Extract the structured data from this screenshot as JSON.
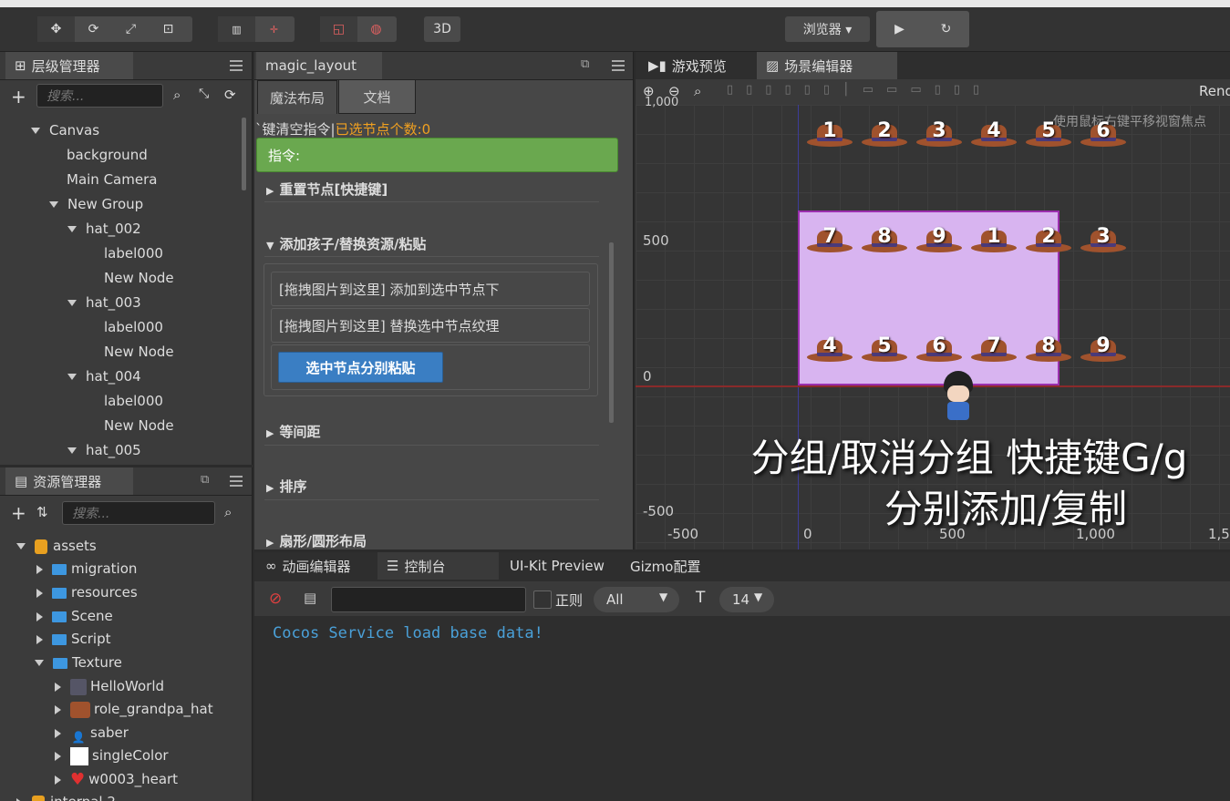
{
  "toolbar": {
    "browser_label": "浏览器 ▾",
    "btn_3d": "3D"
  },
  "hierarchy": {
    "title": "层级管理器",
    "search_placeholder": "搜索...",
    "nodes": [
      {
        "label": "Canvas",
        "expanded": true
      },
      {
        "label": "background"
      },
      {
        "label": "Main Camera"
      },
      {
        "label": "New Group",
        "expanded": true
      },
      {
        "label": "hat_002",
        "expanded": true
      },
      {
        "label": "label000"
      },
      {
        "label": "New Node"
      },
      {
        "label": "hat_003",
        "expanded": true
      },
      {
        "label": "label000"
      },
      {
        "label": "New Node"
      },
      {
        "label": "hat_004",
        "expanded": true
      },
      {
        "label": "label000"
      },
      {
        "label": "New Node"
      },
      {
        "label": "hat_005",
        "expanded": true
      }
    ]
  },
  "assets": {
    "title": "资源管理器",
    "search_placeholder": "搜索...",
    "items": [
      {
        "label": "assets"
      },
      {
        "label": "migration"
      },
      {
        "label": "resources"
      },
      {
        "label": "Scene"
      },
      {
        "label": "Script"
      },
      {
        "label": "Texture"
      },
      {
        "label": "HelloWorld"
      },
      {
        "label": "role_grandpa_hat"
      },
      {
        "label": "saber"
      },
      {
        "label": "singleColor"
      },
      {
        "label": "w0003_heart"
      },
      {
        "label": "internal 2"
      }
    ]
  },
  "magic": {
    "tab_title": "magic_layout",
    "subtab_layout": "魔法布局",
    "subtab_doc": "文档",
    "status_prefix": "`键清空指令|",
    "status_selected": "已选节点个数:0",
    "command_label": "指令:",
    "sections": {
      "reset": "重置节点[快捷键]",
      "add": "添加孩子/替换资源/粘贴",
      "spacing": "等间距",
      "sort": "排序",
      "circle": "扇形/圆形布局"
    },
    "drop_add": "[拖拽图片到这里] 添加到选中节点下",
    "drop_replace": "[拖拽图片到这里] 替换选中节点纹理",
    "paste_button": "选中节点分别粘贴"
  },
  "scene": {
    "tab_game": "游戏预览",
    "tab_scene": "场景编辑器",
    "render_label": "Rend",
    "hint": "使用鼠标右键平移视窗焦点",
    "axis_y": {
      "top": "1,000",
      "mid": "500",
      "zero": "0",
      "neg": "-500"
    },
    "axis_x": {
      "neg": "-500",
      "zero": "0",
      "p500": "500",
      "p1000": "1,000",
      "p1500": "1,5"
    },
    "overlay_line1": "分组/取消分组 快捷键G/g",
    "overlay_line2": "分别添加/复制",
    "hats_row1": [
      "1",
      "2",
      "3",
      "4",
      "5",
      "6"
    ],
    "hats_row2": [
      "7",
      "8",
      "9",
      "1",
      "2",
      "3"
    ],
    "hats_row3": [
      "4",
      "5",
      "6",
      "7",
      "8",
      "9"
    ],
    "hat_color": "#a0522d",
    "selection_color": "#d8b4f0"
  },
  "console": {
    "tab_anim": "动画编辑器",
    "tab_console": "控制台",
    "tab_uikit": "UI-Kit Preview",
    "tab_gizmo": "Gizmo配置",
    "regex_label": "正则",
    "filter_value": "All",
    "font_size": "14",
    "log_line": "Cocos Service load base data!"
  }
}
